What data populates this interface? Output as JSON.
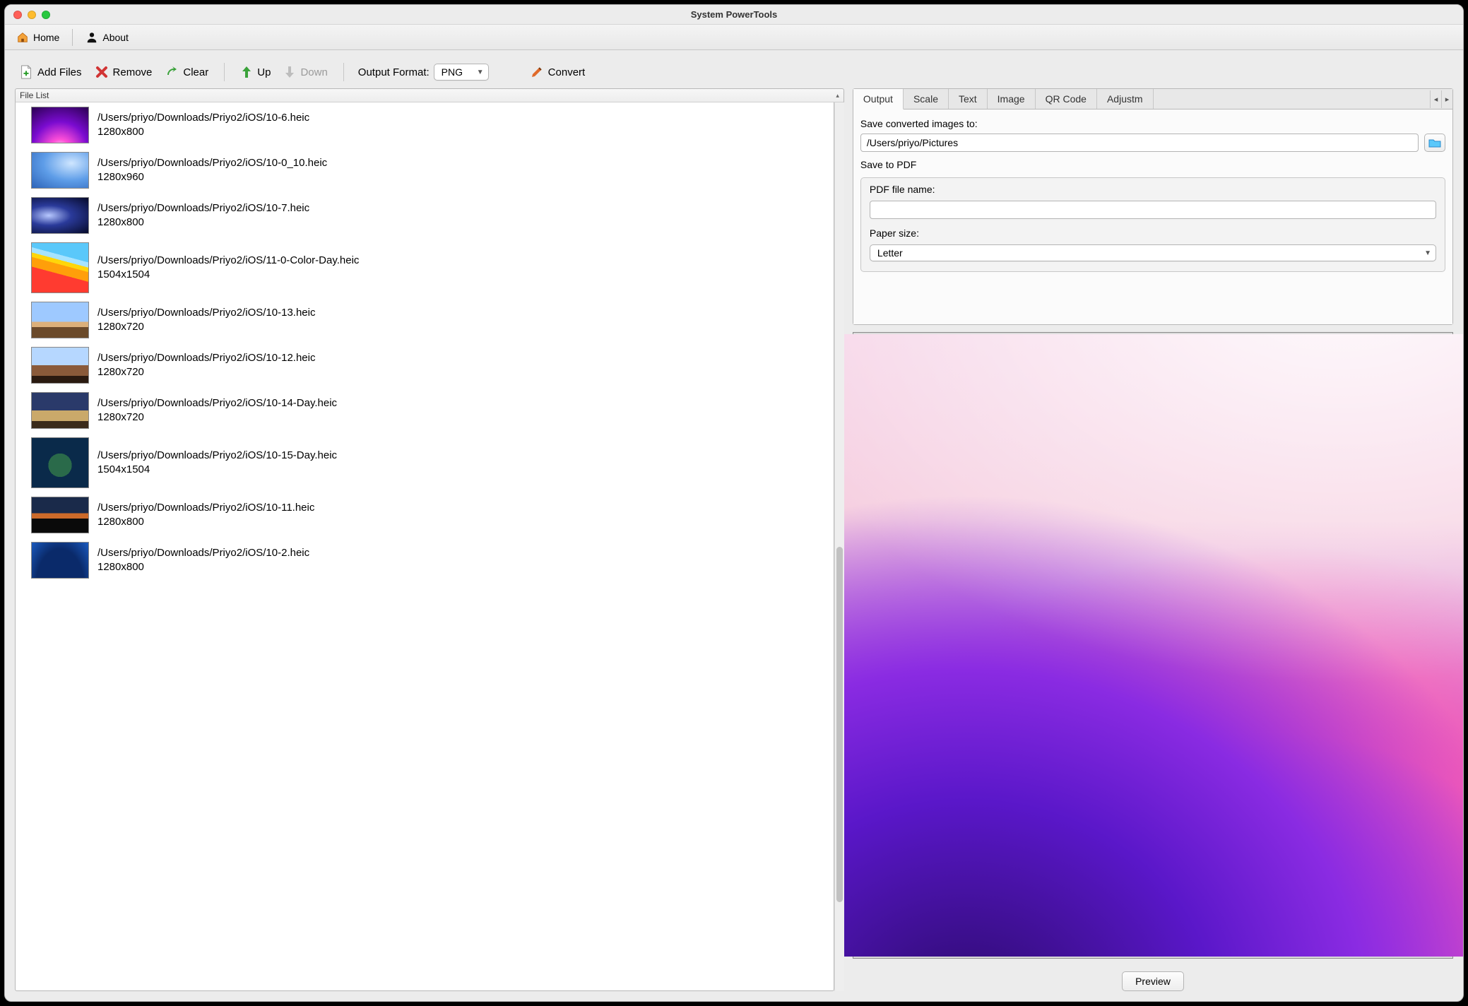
{
  "window": {
    "title": "System PowerTools"
  },
  "menubar": {
    "home": "Home",
    "about": "About"
  },
  "toolbar": {
    "add_files": "Add Files",
    "remove": "Remove",
    "clear": "Clear",
    "up": "Up",
    "down": "Down",
    "output_format_label": "Output Format:",
    "output_format_value": "PNG",
    "convert": "Convert"
  },
  "filelist_header": "File List",
  "files": [
    {
      "path": "/Users/priyo/Downloads/Priyo2/iOS/10-6.heic",
      "dims": "1280x800"
    },
    {
      "path": "/Users/priyo/Downloads/Priyo2/iOS/10-0_10.heic",
      "dims": "1280x960"
    },
    {
      "path": "/Users/priyo/Downloads/Priyo2/iOS/10-7.heic",
      "dims": "1280x800"
    },
    {
      "path": "/Users/priyo/Downloads/Priyo2/iOS/11-0-Color-Day.heic",
      "dims": "1504x1504"
    },
    {
      "path": "/Users/priyo/Downloads/Priyo2/iOS/10-13.heic",
      "dims": "1280x720"
    },
    {
      "path": "/Users/priyo/Downloads/Priyo2/iOS/10-12.heic",
      "dims": "1280x720"
    },
    {
      "path": "/Users/priyo/Downloads/Priyo2/iOS/10-14-Day.heic",
      "dims": "1280x720"
    },
    {
      "path": "/Users/priyo/Downloads/Priyo2/iOS/10-15-Day.heic",
      "dims": "1504x1504"
    },
    {
      "path": "/Users/priyo/Downloads/Priyo2/iOS/10-11.heic",
      "dims": "1280x800"
    },
    {
      "path": "/Users/priyo/Downloads/Priyo2/iOS/10-2.heic",
      "dims": "1280x800"
    }
  ],
  "tabs": {
    "items": [
      "Output",
      "Scale",
      "Text",
      "Image",
      "QR Code",
      "Adjustm"
    ],
    "active_index": 0
  },
  "output_panel": {
    "save_to_label": "Save converted images to:",
    "save_to_value": "/Users/priyo/Pictures",
    "save_to_pdf_label": "Save to PDF",
    "pdf_filename_label": "PDF file name:",
    "pdf_filename_value": "",
    "paper_size_label": "Paper size:",
    "paper_size_value": "Letter"
  },
  "preview_button": "Preview"
}
